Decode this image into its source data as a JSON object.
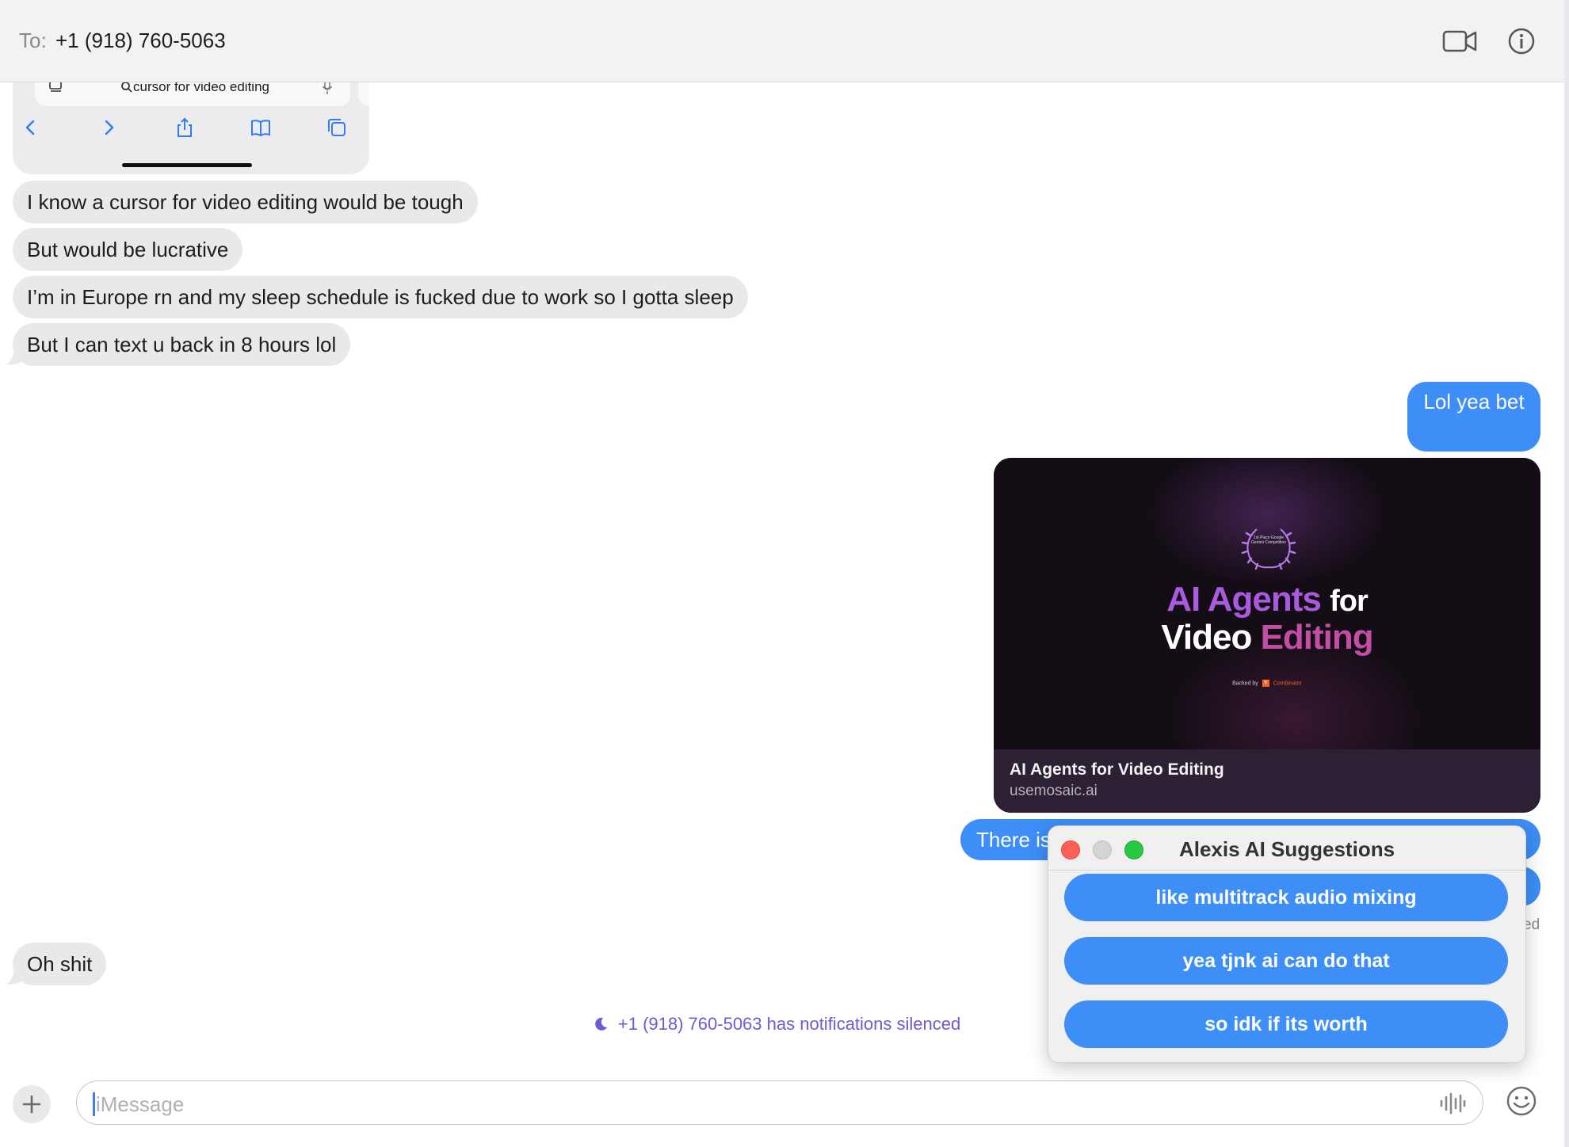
{
  "header": {
    "to_label": "To:",
    "recipient": "+1 (918) 760-5063",
    "icons": [
      "video-camera-icon",
      "info-icon"
    ]
  },
  "screenshot_fragment": {
    "search_query": "cursor for video editing",
    "icons": [
      "tabs-icon",
      "search-icon",
      "mic-icon",
      "back-icon",
      "forward-icon",
      "share-icon",
      "bookmarks-icon",
      "tabs-overview-icon"
    ]
  },
  "messages": {
    "incoming_1": "I know a cursor for video editing would be tough",
    "incoming_2": "But would be lucrative",
    "incoming_3": "I’m in Europe rn and my sleep schedule is fucked due to work so I gotta sleep",
    "incoming_4": "But I can text u back in 8 hours lol",
    "outgoing_1": "Lol yea bet",
    "outgoing_2_partial": "There is",
    "status_partial": "ed",
    "incoming_5": "Oh shit"
  },
  "link_card": {
    "hero_word1": "AI Agents",
    "hero_word2": "for",
    "hero_word3": "Video",
    "hero_word4": "Editing",
    "laurel_text": "1st Place Google Gemini Competition",
    "backed_by": "Backed by",
    "yc_letter": "Y",
    "yc_name": "Combinator",
    "title": "AI Agents for Video Editing",
    "domain": "usemosaic.ai"
  },
  "notice": {
    "text": "+1 (918) 760-5063 has notifications silenced",
    "icon": "moon-icon"
  },
  "composer": {
    "placeholder": "iMessage",
    "icons": [
      "plus-icon",
      "audio-wave-icon",
      "emoji-icon"
    ]
  },
  "suggestions": {
    "title": "Alexis AI Suggestions",
    "items": [
      "like multitrack audio mixing",
      "yea tjnk ai can do that",
      "so idk if its worth"
    ]
  },
  "colors": {
    "imessage_blue": "#3d8ef7",
    "incoming_gray": "#e9e9eb",
    "silenced_purple": "#6a5dd3",
    "card_bg": "#140d15"
  }
}
